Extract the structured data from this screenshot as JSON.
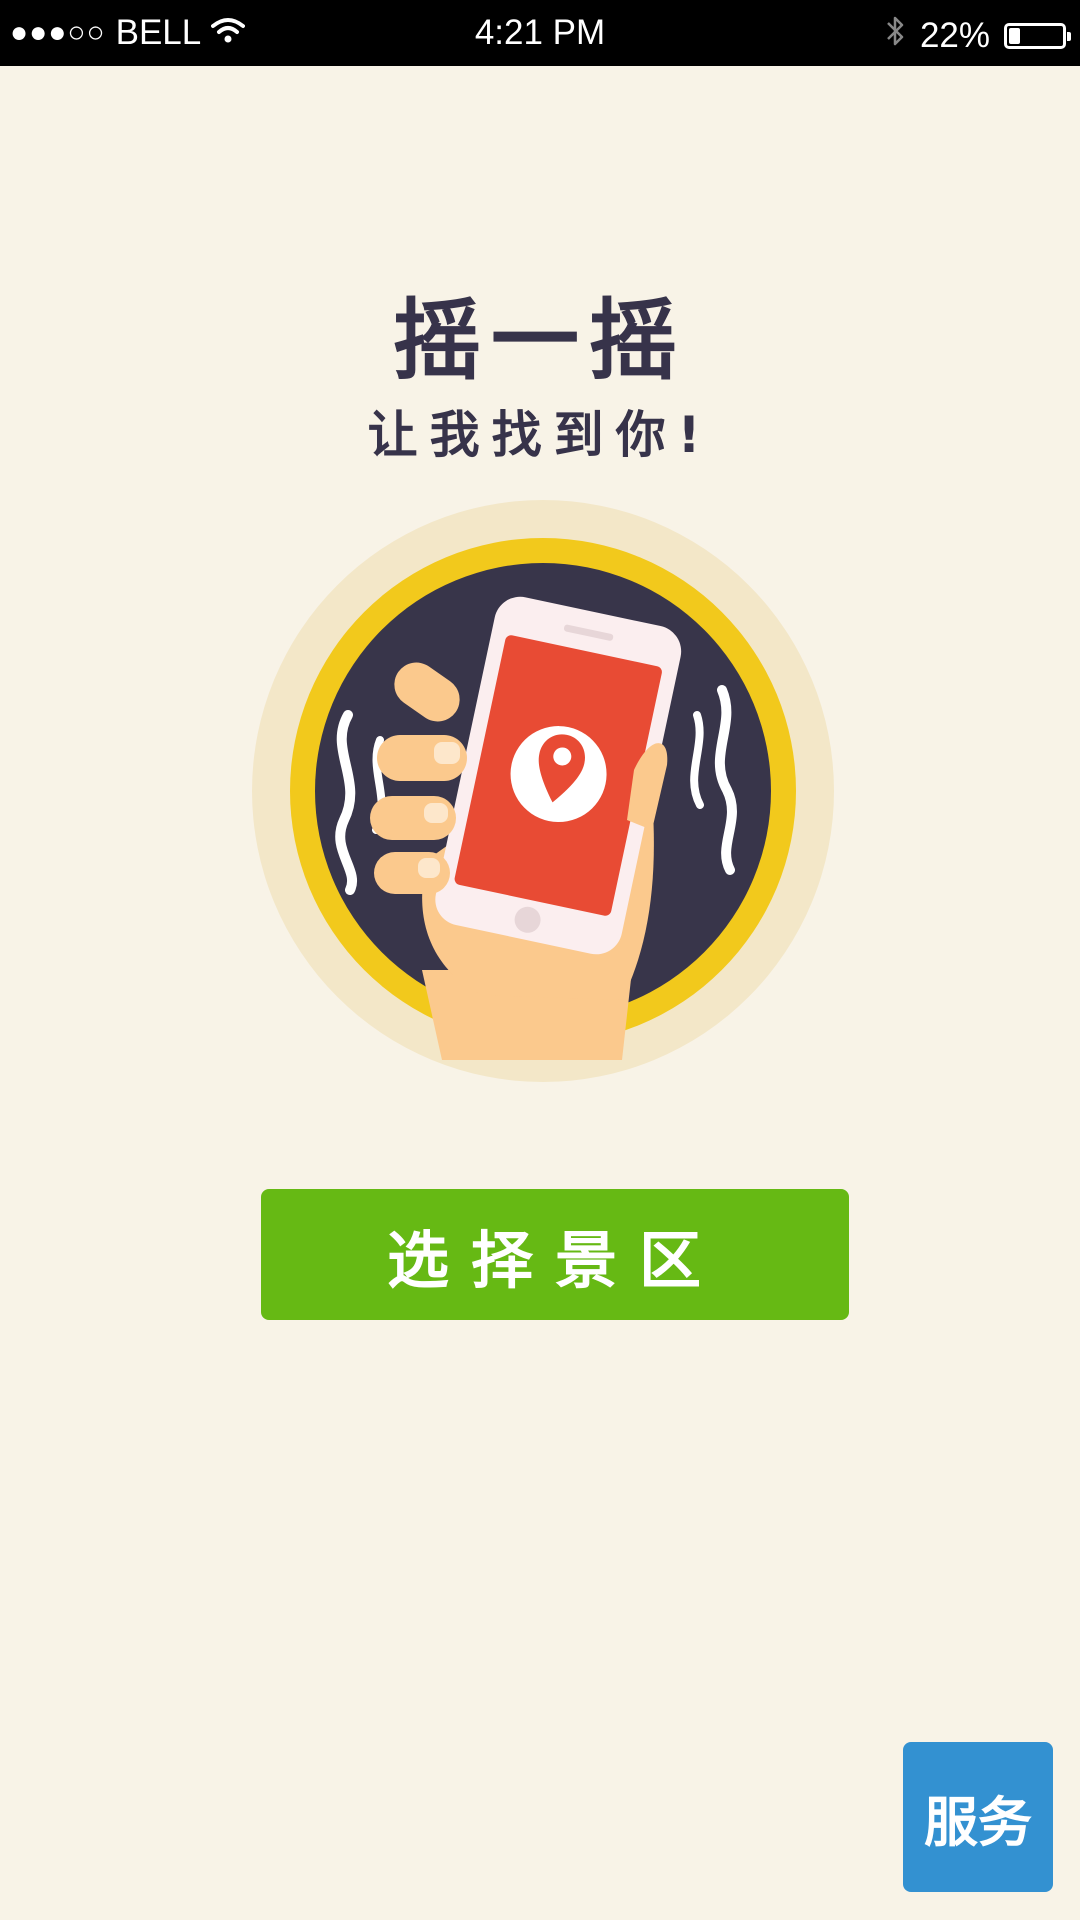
{
  "status_bar": {
    "signal": "●●●○○",
    "carrier": "BELL",
    "time": "4:21 PM",
    "battery_percent": "22%",
    "battery_level": 0.22,
    "icons": [
      "wifi-icon",
      "bluetooth-icon",
      "battery-icon"
    ]
  },
  "main": {
    "title": "摇一摇",
    "subtitle": "让我找到你!",
    "illustration_icon": "hand-shaking-phone-location-icon",
    "select_button_label": "选择景区",
    "service_button_label": "服务"
  },
  "colors": {
    "background": "#f8f3e7",
    "select_button": "#66b914",
    "service_button": "#3391d1",
    "ring": "#f2c91c",
    "circle": "#38354a",
    "phone_screen": "#e84b34"
  }
}
